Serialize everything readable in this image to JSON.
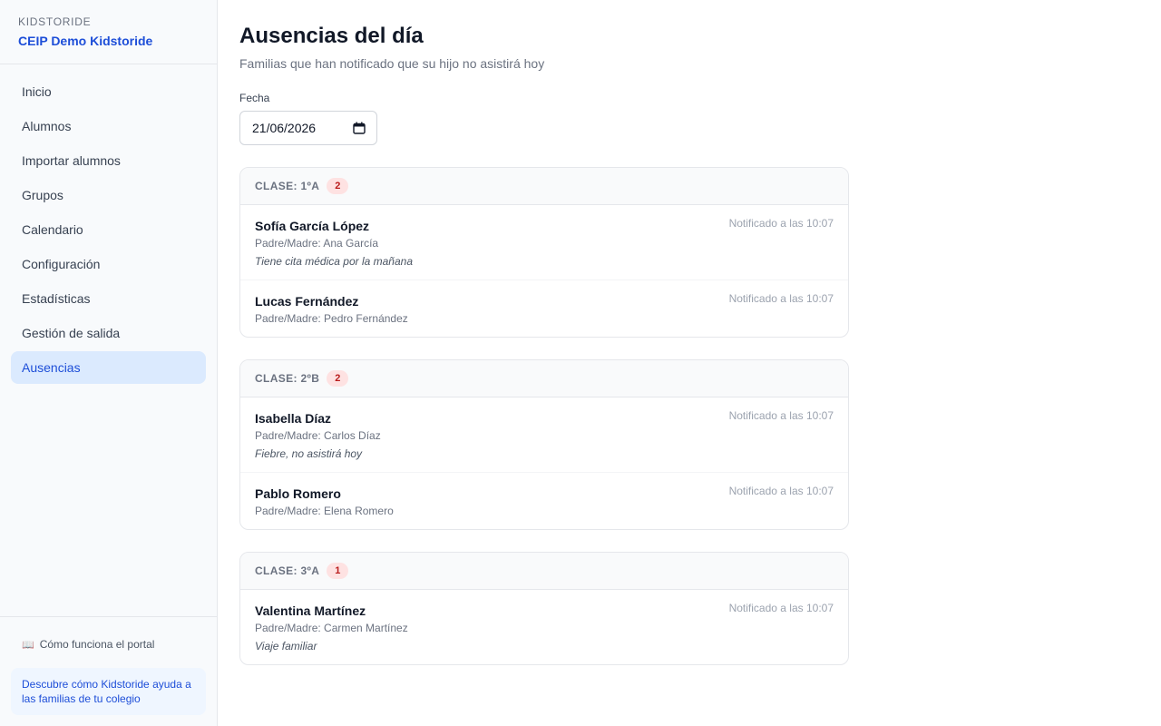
{
  "sidebar": {
    "eyebrow": "KIDSTORIDE",
    "school_name": "CEIP Demo Kidstoride",
    "nav": [
      {
        "label": "Inicio"
      },
      {
        "label": "Alumnos"
      },
      {
        "label": "Importar alumnos"
      },
      {
        "label": "Grupos"
      },
      {
        "label": "Calendario"
      },
      {
        "label": "Configuración"
      },
      {
        "label": "Estadísticas"
      },
      {
        "label": "Gestión de salida"
      },
      {
        "label": "Ausencias",
        "active": true
      }
    ],
    "help_icon": "book-icon",
    "help_link": "Cómo funciona el portal",
    "promo_text": "Descubre cómo Kidstoride ayuda a las familias de tu colegio"
  },
  "page": {
    "title": "Ausencias del día",
    "subtitle": "Familias que han notificado que su hijo no asistirá hoy",
    "date_label": "Fecha",
    "date_value": "21/06/2026"
  },
  "classes": [
    {
      "title": "CLASE: 1ºA",
      "count": "2",
      "absences": [
        {
          "student": "Sofía García López",
          "parent": "Padre/Madre: Ana García",
          "note": "Tiene cita médica por la mañana",
          "time": "Notificado a las 10:07"
        },
        {
          "student": "Lucas Fernández",
          "parent": "Padre/Madre: Pedro Fernández",
          "note": "",
          "time": "Notificado a las 10:07"
        }
      ]
    },
    {
      "title": "CLASE: 2ºB",
      "count": "2",
      "absences": [
        {
          "student": "Isabella Díaz",
          "parent": "Padre/Madre: Carlos Díaz",
          "note": "Fiebre, no asistirá hoy",
          "time": "Notificado a las 10:07"
        },
        {
          "student": "Pablo Romero",
          "parent": "Padre/Madre: Elena Romero",
          "note": "",
          "time": "Notificado a las 10:07"
        }
      ]
    },
    {
      "title": "CLASE: 3ºA",
      "count": "1",
      "absences": [
        {
          "student": "Valentina Martínez",
          "parent": "Padre/Madre: Carmen Martínez",
          "note": "Viaje familiar",
          "time": "Notificado a las 10:07"
        }
      ]
    }
  ],
  "colors": {
    "accent": "#1d4ed8",
    "active_nav_bg": "#dbeafe",
    "badge_bg": "#fee2e2",
    "badge_text": "#b91c1c"
  }
}
